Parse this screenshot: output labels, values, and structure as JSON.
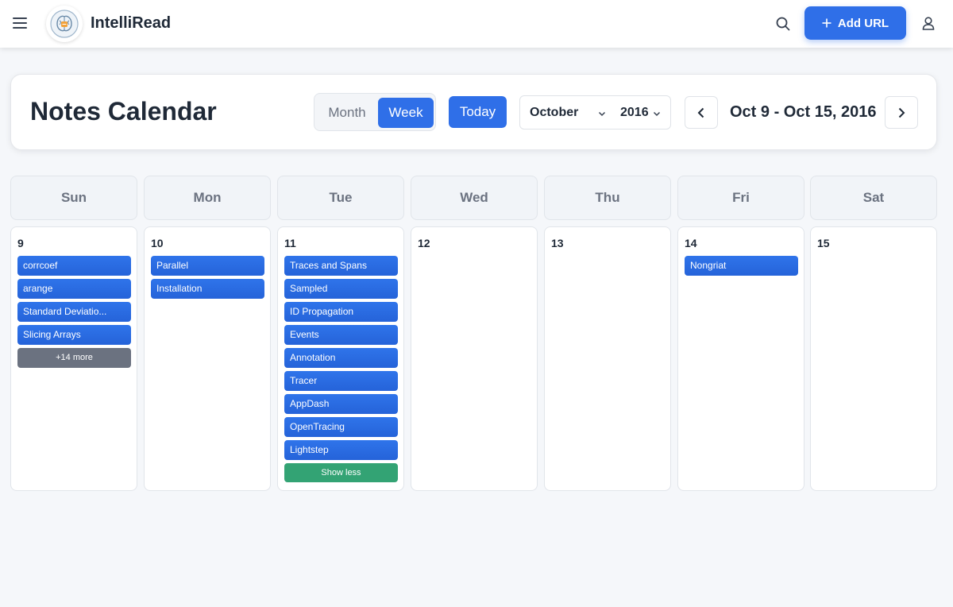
{
  "app": {
    "name": "IntelliRead",
    "add_url_label": "Add URL"
  },
  "header": {
    "title": "Notes Calendar",
    "view_month": "Month",
    "view_week": "Week",
    "active_view": "Week",
    "today_label": "Today",
    "month_value": "October",
    "year_value": "2016",
    "range_label": "Oct 9 - Oct 15, 2016"
  },
  "colors": {
    "accent": "#2f6fe8",
    "more_button": "#6b7280",
    "less_button": "#33a374"
  },
  "days": [
    {
      "weekday": "Sun",
      "date": "9",
      "notes": [
        "corrcoef",
        "arange",
        "Standard Deviatio...",
        "Slicing Arrays"
      ],
      "more_label": "+14 more"
    },
    {
      "weekday": "Mon",
      "date": "10",
      "notes": [
        "Parallel",
        "Installation"
      ]
    },
    {
      "weekday": "Tue",
      "date": "11",
      "notes": [
        "Traces and Spans",
        "Sampled",
        "ID Propagation",
        "Events",
        "Annotation",
        "Tracer",
        "AppDash",
        "OpenTracing",
        "Lightstep"
      ],
      "less_label": "Show less"
    },
    {
      "weekday": "Wed",
      "date": "12",
      "notes": []
    },
    {
      "weekday": "Thu",
      "date": "13",
      "notes": []
    },
    {
      "weekday": "Fri",
      "date": "14",
      "notes": [
        "Nongriat"
      ]
    },
    {
      "weekday": "Sat",
      "date": "15",
      "notes": []
    }
  ]
}
